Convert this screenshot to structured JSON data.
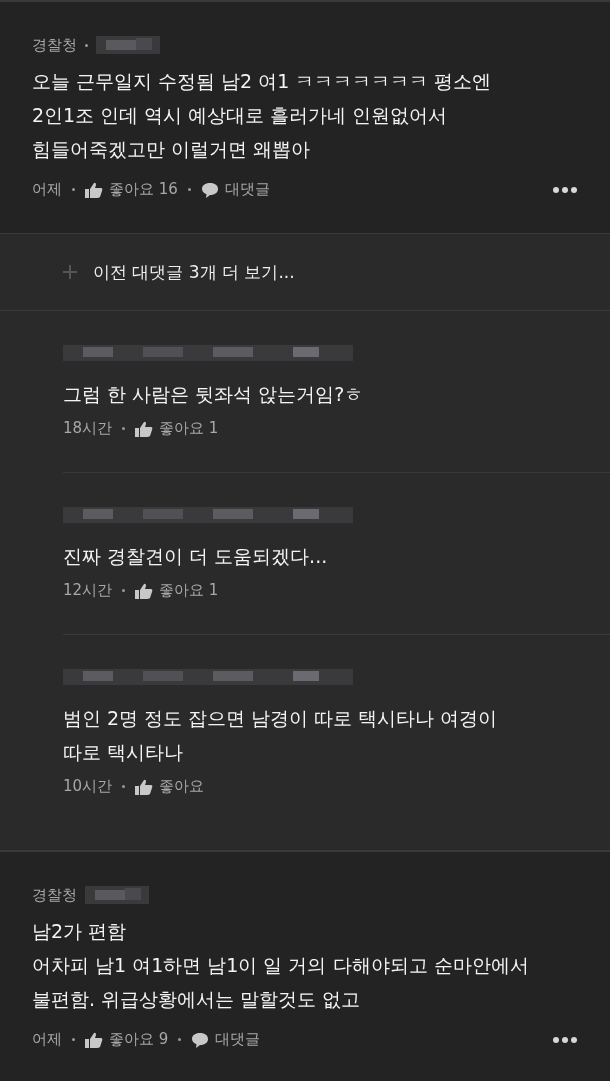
{
  "thread": [
    {
      "kind": "comment",
      "company": "경찰청",
      "dot": true,
      "lines": [
        "오늘 근무일지 수정됨 남2 여1 ㅋㅋㅋㅋㅋㅋㅋ 평소엔",
        "2인1조 인데 역시 예상대로 흘러가네 인원없어서",
        "힘들어죽겠고만 이럴거면 왜뽑아"
      ],
      "time": "어제",
      "likes": "좋아요 16",
      "reply_label": "대댓글"
    },
    {
      "kind": "more",
      "label": "이전 대댓글 3개 더 보기..."
    },
    {
      "kind": "reply",
      "lines": [
        "그럼 한 사람은 뒷좌석 앉는거임?ㅎ"
      ],
      "time": "18시간",
      "likes": "좋아요 1"
    },
    {
      "kind": "reply",
      "lines": [
        "진짜 경찰견이 더 도움되겠다..."
      ],
      "time": "12시간",
      "likes": "좋아요 1"
    },
    {
      "kind": "reply",
      "lines": [
        "범인 2명 정도 잡으면 남경이 따로 택시타나 여경이",
        "따로 택시타나"
      ],
      "time": "10시간",
      "likes": "좋아요"
    },
    {
      "kind": "comment",
      "company": "경찰청",
      "dot": false,
      "lines": [
        "남2가 편함",
        "어차피 남1 여1하면 남1이 일 거의 다해야되고 순마안에서",
        "불편함. 위급상황에서는 말할것도 없고"
      ],
      "time": "어제",
      "likes": "좋아요 9",
      "reply_label": "대댓글"
    }
  ]
}
